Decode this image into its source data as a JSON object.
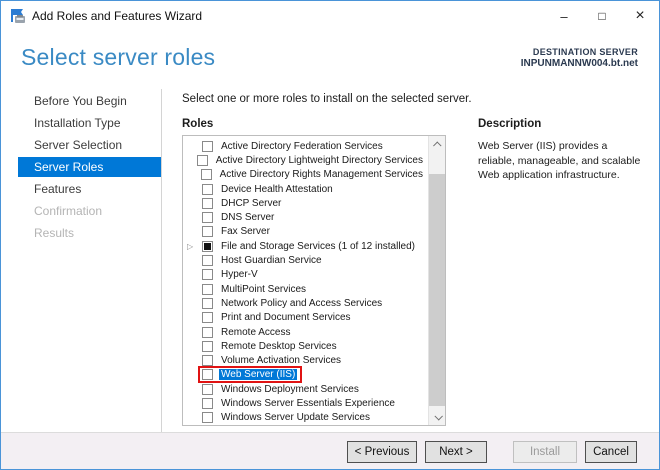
{
  "window": {
    "title": "Add Roles and Features Wizard",
    "controls": {
      "minimize": "–",
      "maximize": "□",
      "close": "×"
    }
  },
  "header": {
    "title": "Select server roles",
    "destination_label": "DESTINATION SERVER",
    "destination_server": "INPUNMANNW004.bt.net"
  },
  "sidebar": {
    "items": [
      {
        "label": "Before You Begin",
        "state": "normal"
      },
      {
        "label": "Installation Type",
        "state": "normal"
      },
      {
        "label": "Server Selection",
        "state": "normal"
      },
      {
        "label": "Server Roles",
        "state": "selected"
      },
      {
        "label": "Features",
        "state": "normal"
      },
      {
        "label": "Confirmation",
        "state": "disabled"
      },
      {
        "label": "Results",
        "state": "disabled"
      }
    ]
  },
  "main": {
    "instruction": "Select one or more roles to install on the selected server.",
    "roles_label": "Roles",
    "roles": [
      {
        "label": "Active Directory Federation Services",
        "checked": false
      },
      {
        "label": "Active Directory Lightweight Directory Services",
        "checked": false
      },
      {
        "label": "Active Directory Rights Management Services",
        "checked": false
      },
      {
        "label": "Device Health Attestation",
        "checked": false
      },
      {
        "label": "DHCP Server",
        "checked": false
      },
      {
        "label": "DNS Server",
        "checked": false
      },
      {
        "label": "Fax Server",
        "checked": false
      },
      {
        "label": "File and Storage Services (1 of 12 installed)",
        "checked": "indeterminate",
        "expander": true
      },
      {
        "label": "Host Guardian Service",
        "checked": false
      },
      {
        "label": "Hyper-V",
        "checked": false
      },
      {
        "label": "MultiPoint Services",
        "checked": false
      },
      {
        "label": "Network Policy and Access Services",
        "checked": false
      },
      {
        "label": "Print and Document Services",
        "checked": false
      },
      {
        "label": "Remote Access",
        "checked": false
      },
      {
        "label": "Remote Desktop Services",
        "checked": false
      },
      {
        "label": "Volume Activation Services",
        "checked": false
      },
      {
        "label": "Web Server (IIS)",
        "checked": false,
        "highlighted": true,
        "annotated": true
      },
      {
        "label": "Windows Deployment Services",
        "checked": false
      },
      {
        "label": "Windows Server Essentials Experience",
        "checked": false
      },
      {
        "label": "Windows Server Update Services",
        "checked": false
      }
    ],
    "description": {
      "label": "Description",
      "text": "Web Server (IIS) provides a reliable, manageable, and scalable Web application infrastructure."
    }
  },
  "footer": {
    "buttons": [
      {
        "label": "< Previous",
        "enabled": true
      },
      {
        "label": "Next >",
        "enabled": true
      },
      {
        "label": "Install",
        "enabled": false
      },
      {
        "label": "Cancel",
        "enabled": true
      }
    ]
  },
  "colors": {
    "accent": "#0078d7",
    "heading": "#3a8ac4",
    "annotation_red": "#e01313",
    "window_border": "#4a94d8"
  }
}
